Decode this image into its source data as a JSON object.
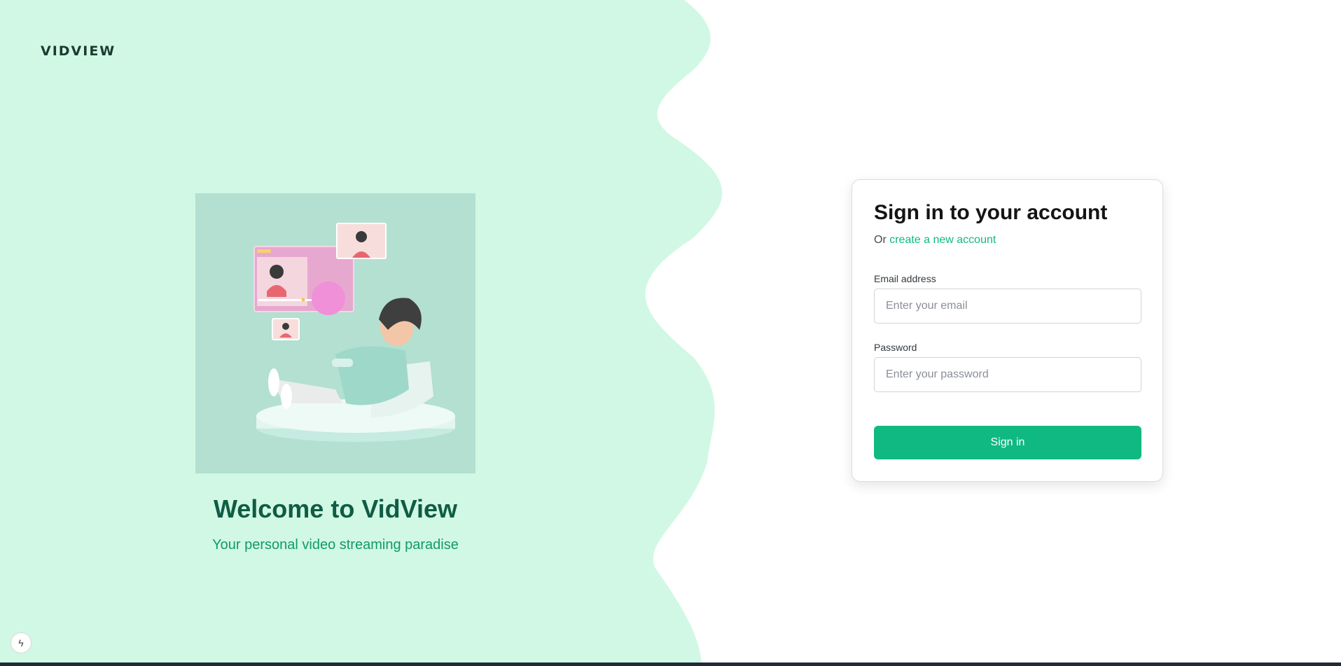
{
  "brand": {
    "logo_text": "VIDVIEW"
  },
  "hero": {
    "image_label": "person-watching-video-illustration",
    "welcome_title": "Welcome to VidView",
    "tagline": "Your personal video streaming paradise"
  },
  "signin": {
    "title": "Sign in to your account",
    "subtitle_prefix": "Or ",
    "create_account_link": "create a new account",
    "email_label": "Email address",
    "email_placeholder": "Enter your email",
    "email_value": "",
    "password_label": "Password",
    "password_placeholder": "Enter your password",
    "password_value": "",
    "submit_label": "Sign in"
  },
  "devtools": {
    "icon": "lightning-bolt-icon",
    "glyph": "ϟ"
  },
  "colors": {
    "mint_background": "#d1f8e4",
    "accent_green": "#10b981",
    "heading_dark_green": "#0f5c44",
    "tagline_green": "#109a6a"
  }
}
